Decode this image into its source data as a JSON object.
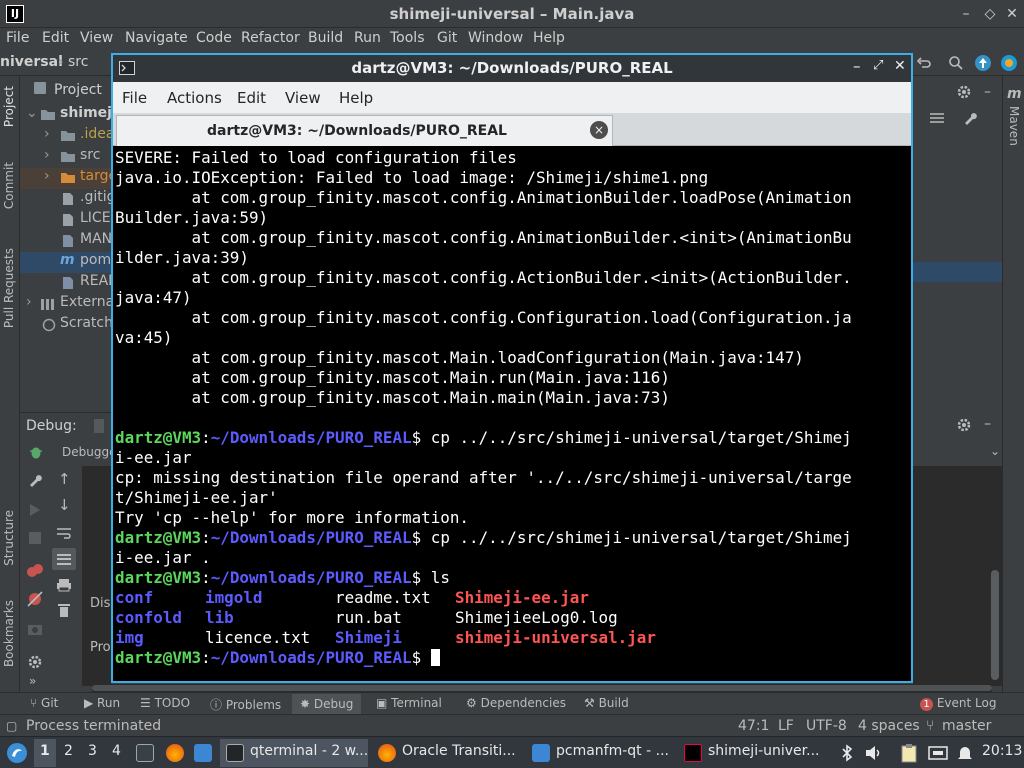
{
  "ide": {
    "app_icon": "IJ",
    "title": "shimeji-universal – Main.java",
    "window_controls": {
      "minimize": "–",
      "restore": "◇",
      "close": "✕"
    },
    "menu": [
      "File",
      "Edit",
      "View",
      "Navigate",
      "Code",
      "Refactor",
      "Build",
      "Run",
      "Tools",
      "Git",
      "Window",
      "Help"
    ],
    "breadcrumb": {
      "project": "niversal",
      "sep": "›",
      "folder": "src"
    },
    "left_stripe": [
      "Project",
      "Commit",
      "Pull Requests",
      "Structure",
      "Bookmarks"
    ],
    "project_panel": {
      "title": "Project",
      "tree": [
        {
          "label": "shimej",
          "indent": 0,
          "icon": "folder-icon"
        },
        {
          "label": ".idea",
          "indent": 1,
          "icon": "folder-icon"
        },
        {
          "label": "src",
          "indent": 1,
          "icon": "folder-icon"
        },
        {
          "label": "targe",
          "indent": 1,
          "icon": "folder-icon"
        },
        {
          "label": ".gitig",
          "indent": 1,
          "icon": "file-icon"
        },
        {
          "label": "LICEI",
          "indent": 1,
          "icon": "file-icon"
        },
        {
          "label": "MAN",
          "indent": 1,
          "icon": "file-icon"
        },
        {
          "label": "pom",
          "indent": 1,
          "icon": "maven-icon"
        },
        {
          "label": "READ",
          "indent": 1,
          "icon": "file-icon"
        },
        {
          "label": "Externa",
          "indent": 0,
          "icon": "library-icon"
        },
        {
          "label": "Scratch",
          "indent": 0,
          "icon": "scratch-icon"
        }
      ]
    },
    "right_stripe": [
      "Maven"
    ],
    "debug": {
      "label": "Debug:",
      "tab": "Debugge",
      "console_frag_1": "Dis",
      "console_frag_2": "Pro"
    },
    "tool_strip": [
      "Git",
      "Run",
      "TODO",
      "Problems",
      "Debug",
      "Terminal",
      "Dependencies",
      "Build"
    ],
    "event_log": {
      "count": "1",
      "label": "Event Log"
    },
    "status": {
      "message": "Process terminated",
      "position": "47:1",
      "line_sep": "LF",
      "encoding": "UTF-8",
      "indent": "4 spaces",
      "branch": "master"
    }
  },
  "terminal": {
    "title": "dartz@VM3: ~/Downloads/PURO_REAL",
    "menu": [
      "File",
      "Actions",
      "Edit",
      "View",
      "Help"
    ],
    "tab_label": "dartz@VM3: ~/Downloads/PURO_REAL",
    "tab_close": "×",
    "prompt_user": "dartz@VM3",
    "prompt_colon": ":",
    "prompt_path": "~/Downloads/PURO_REAL",
    "prompt_sign": "$",
    "output_lines": [
      "SEVERE: Failed to load configuration files",
      "java.io.IOException: Failed to load image: /Shimeji/shime1.png",
      "        at com.group_finity.mascot.config.AnimationBuilder.loadPose(Animation",
      "Builder.java:59)",
      "        at com.group_finity.mascot.config.AnimationBuilder.<init>(AnimationBu",
      "ilder.java:39)",
      "        at com.group_finity.mascot.config.ActionBuilder.<init>(ActionBuilder.",
      "java:47)",
      "        at com.group_finity.mascot.config.Configuration.load(Configuration.ja",
      "va:45)",
      "        at com.group_finity.mascot.Main.loadConfiguration(Main.java:147)",
      "        at com.group_finity.mascot.Main.run(Main.java:116)",
      "        at com.group_finity.mascot.Main.main(Main.java:73)"
    ],
    "cmd1_a": " cp ../../src/shimeji-universal/target/Shimej",
    "cmd1_b": "i-ee.jar",
    "err1_a": "cp: missing destination file operand after '../../src/shimeji-universal/targe",
    "err1_b": "t/Shimeji-ee.jar'",
    "err2": "Try 'cp --help' for more information.",
    "cmd2_a": " cp ../../src/shimeji-universal/target/Shimej",
    "cmd2_b": "i-ee.jar .",
    "cmd3": " ls",
    "ls": [
      [
        "conf",
        "imgold",
        "readme.txt",
        "Shimeji-ee.jar"
      ],
      [
        "confold",
        "lib",
        "run.bat",
        "ShimejieeLog0.log"
      ],
      [
        "img",
        "licence.txt",
        "Shimeji",
        "shimeji-universal.jar"
      ]
    ]
  },
  "taskbar": {
    "workspaces": [
      "1",
      "2",
      "3",
      "4"
    ],
    "tasks": [
      "qterminal - 2 w...",
      "Oracle Transiti...",
      "pcmanfm-qt - ...",
      "shimeji-univer..."
    ],
    "clock": "20:13"
  },
  "colors": {
    "accent": "#3daee9",
    "prompt_user": "#5bd75b",
    "prompt_path": "#5b5bff",
    "archive": "#ff5454"
  }
}
